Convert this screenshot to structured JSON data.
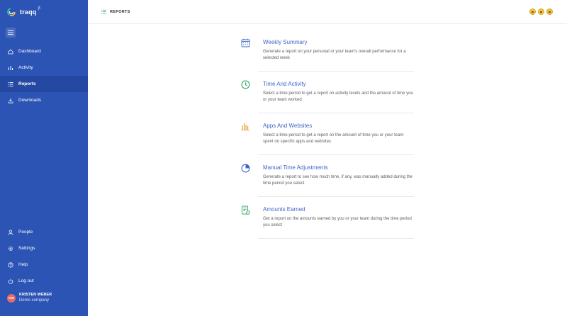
{
  "app": {
    "name": "traqq",
    "badge": "β"
  },
  "header": {
    "title": "REPORTS",
    "emojis": [
      "face-icon",
      "face-icon",
      "face-icon"
    ]
  },
  "sidebar": {
    "top_items": [
      {
        "label": "Dashboard",
        "icon": "home-icon",
        "active": false
      },
      {
        "label": "Activity",
        "icon": "bar-chart-icon",
        "active": false
      },
      {
        "label": "Reports",
        "icon": "list-icon",
        "active": true
      },
      {
        "label": "Downloads",
        "icon": "download-icon",
        "active": false
      }
    ],
    "bottom_items": [
      {
        "label": "People",
        "icon": "person-icon"
      },
      {
        "label": "Settings",
        "icon": "gear-icon"
      },
      {
        "label": "Help",
        "icon": "help-icon"
      },
      {
        "label": "Log out",
        "icon": "power-icon"
      }
    ],
    "user": {
      "initials": "KW",
      "name": "KRISTEN WEBER",
      "company": "Demo company"
    }
  },
  "reports": [
    {
      "title": "Weekly Summary",
      "description": "Generate a report on your personal or your team's overall performance for a selected week",
      "icon": "calendar-icon"
    },
    {
      "title": "Time And Activity",
      "description": "Select a time period to get a report on activity levels and the amount of time you or your team worked",
      "icon": "clock-icon"
    },
    {
      "title": "Apps And Websites",
      "description": "Select a time period to get a report on the amount of time you or your team spent on specific apps and websites",
      "icon": "bars-icon"
    },
    {
      "title": "Manual Time Adjustments",
      "description": "Generate a report to see how much time, if any, was manually added during the time period you select",
      "icon": "pie-icon"
    },
    {
      "title": "Amounts Earned",
      "description": "Get a report on the amounts earned by you or your team during the time period you select",
      "icon": "document-money-icon"
    }
  ],
  "colors": {
    "sidebar_bg": "#2c54b5",
    "sidebar_active": "#2549a3",
    "link": "#3f66c7",
    "icon_blue": "#3f66c7",
    "icon_green": "#37a96a",
    "icon_orange": "#e9a23b",
    "avatar": "#e96a6a"
  }
}
